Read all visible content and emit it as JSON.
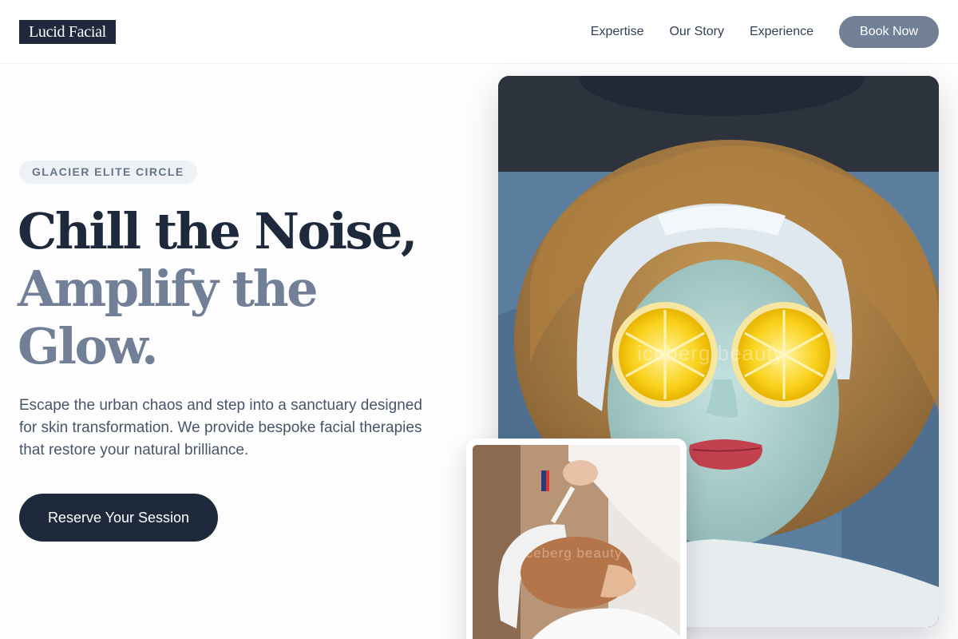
{
  "brand": {
    "logo": "Lucid Facial"
  },
  "nav": {
    "links": [
      "Expertise",
      "Our Story",
      "Experience"
    ],
    "book_button": "Book Now"
  },
  "hero": {
    "badge": "GLACIER ELITE CIRCLE",
    "headline_line1": "Chill the Noise,",
    "headline_line2": "Amplify the Glow.",
    "description": "Escape the urban chaos and step into a sanctuary designed for skin transformation. We provide bespoke facial therapies that restore your natural brilliance.",
    "cta": "Reserve Your Session"
  },
  "images": {
    "main_watermark": "iceberg beauty",
    "small_watermark": "iceberg beauty"
  },
  "colors": {
    "navy": "#1e293b",
    "slate_accent": "#718096",
    "badge_bg": "#eef2f7"
  }
}
